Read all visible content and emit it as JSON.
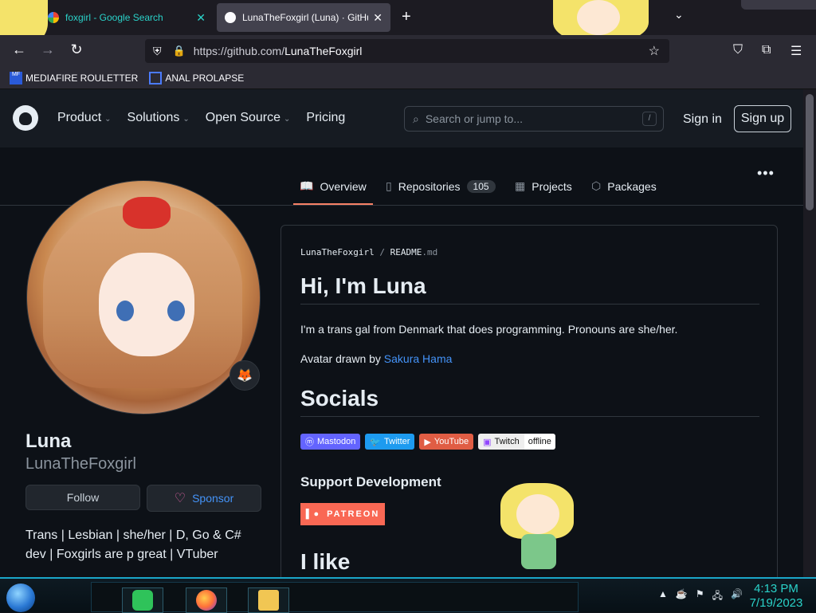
{
  "browser": {
    "tabs": [
      {
        "label": "foxgirl - Google Search",
        "active": false
      },
      {
        "label": "LunaTheFoxgirl (Luna) · GitHub",
        "active": true
      }
    ],
    "new_tab_icon": "plus-icon",
    "url_host": "https://github.com/",
    "url_path": "LunaTheFoxgirl",
    "bookmarks": [
      {
        "label": "MEDIAFIRE ROULETTER",
        "icon_text": "MF"
      },
      {
        "label": "ANAL PROLAPSE"
      }
    ]
  },
  "github_header": {
    "nav": [
      {
        "label": "Product",
        "has_menu": true
      },
      {
        "label": "Solutions",
        "has_menu": true
      },
      {
        "label": "Open Source",
        "has_menu": true
      },
      {
        "label": "Pricing",
        "has_menu": false
      }
    ],
    "search_placeholder": "Search or jump to...",
    "search_shortcut": "/",
    "signin_label": "Sign in",
    "signup_label": "Sign up"
  },
  "profile_tabs": [
    {
      "label": "Overview",
      "icon": "book-icon",
      "active": true
    },
    {
      "label": "Repositories",
      "icon": "repo-icon",
      "count": "105"
    },
    {
      "label": "Projects",
      "icon": "table-icon"
    },
    {
      "label": "Packages",
      "icon": "package-icon"
    }
  ],
  "profile": {
    "name": "Luna",
    "login": "LunaTheFoxgirl",
    "status_emoji": "🦊",
    "follow_label": "Follow",
    "sponsor_label": "Sponsor",
    "bio": "Trans | Lesbian | she/her | D, Go & C# dev | Foxgirls are p great | VTuber"
  },
  "readme": {
    "path_user": "LunaTheFoxgirl",
    "path_sep": "/",
    "path_file": "README",
    "path_ext": ".md",
    "heading": "Hi, I'm Luna",
    "intro": "I'm a trans gal from Denmark that does programming. Pronouns are she/her.",
    "avatar_credit_prefix": "Avatar drawn by ",
    "avatar_credit_link": "Sakura Hama",
    "socials_heading": "Socials",
    "badges": [
      {
        "label": "Mastodon",
        "color": "#6364ff"
      },
      {
        "label": "Twitter",
        "color": "#1d9bf0"
      },
      {
        "label": "YouTube",
        "color": "#e05d44"
      },
      {
        "label": "Twitch",
        "status": "offline"
      }
    ],
    "support_heading": "Support Development",
    "patreon_label": "PATREON",
    "ilike_heading": "I like"
  },
  "taskbar": {
    "time": "4:13 PM",
    "date": "7/19/2023"
  },
  "colors": {
    "accent_underline": "#f78166",
    "link": "#4493f8",
    "taskbar_accent": "#2ad2c9"
  }
}
